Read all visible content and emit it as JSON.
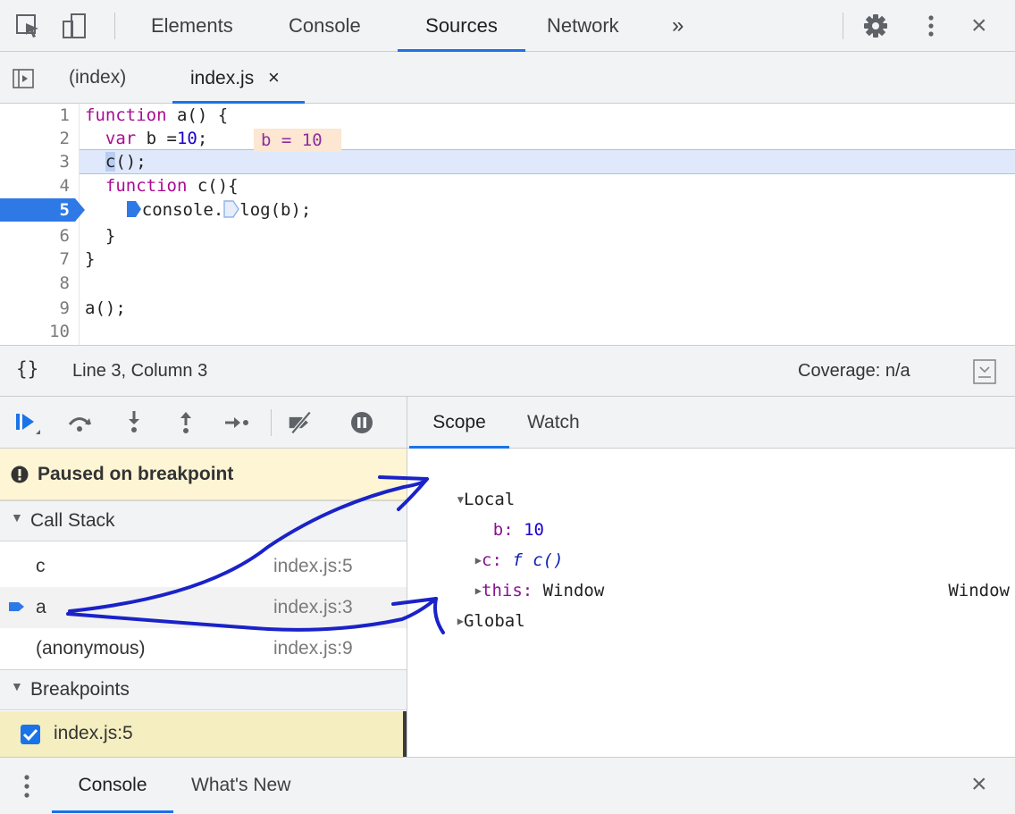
{
  "top_tabs": [
    {
      "label": "Elements"
    },
    {
      "label": "Console"
    },
    {
      "label": "Sources"
    },
    {
      "label": "Network"
    }
  ],
  "more_tabs_label": "»",
  "file_tabs": [
    {
      "label": "(index)"
    },
    {
      "label": "index.js"
    }
  ],
  "file_tab_close": "×",
  "editor": {
    "line_numbers": [
      "1",
      "2",
      "3",
      "4",
      "5",
      "6",
      "7",
      "8",
      "9",
      "10"
    ],
    "current_line": "5",
    "inline_value": "b = 10"
  },
  "status": {
    "braces": "{}",
    "position": "Line 3, Column 3",
    "coverage": "Coverage: n/a"
  },
  "paused_message": "Paused on breakpoint",
  "call_stack": {
    "title": "Call Stack",
    "frames": [
      {
        "name": "c",
        "location": "index.js:5"
      },
      {
        "name": "a",
        "location": "index.js:3"
      },
      {
        "name": "(anonymous)",
        "location": "index.js:9"
      }
    ]
  },
  "breakpoints": {
    "title": "Breakpoints",
    "items": [
      {
        "label": "index.js:5",
        "checked": true
      }
    ]
  },
  "scope_tabs": [
    {
      "label": "Scope"
    },
    {
      "label": "Watch"
    }
  ],
  "scope": {
    "local_label": "Local",
    "vars": [
      {
        "name": "b",
        "value": "10"
      },
      {
        "name": "c",
        "value": "f c()"
      },
      {
        "name": "this",
        "value": "Window"
      }
    ],
    "global_label": "Global",
    "global_value": "Window"
  },
  "drawer_tabs": [
    {
      "label": "Console"
    },
    {
      "label": "What's New"
    }
  ],
  "close_label": "×",
  "colors": {
    "accent": "#1a73e8",
    "paused_bg": "#fdf5d4",
    "breakpoint_bg": "#f4eec0",
    "inline_value_bg": "#fde6d2",
    "annotation_ink": "#1a22c8"
  }
}
